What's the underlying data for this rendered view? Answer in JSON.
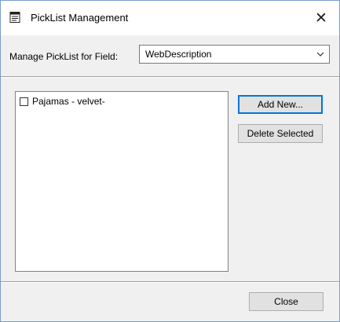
{
  "window": {
    "title": "PickList Management",
    "title_icon": "notepad-icon",
    "close_glyph": "✕"
  },
  "field_selector": {
    "label": "Manage PickList for Field:",
    "selected_value": "WebDescription"
  },
  "picklist": {
    "items": [
      {
        "label": "Pajamas - velvet-",
        "checked": false
      }
    ]
  },
  "buttons": {
    "add_new": "Add New...",
    "delete_selected": "Delete Selected",
    "close": "Close"
  },
  "colors": {
    "accent": "#0078d7",
    "window_border": "#7a9ccc",
    "panel_bg": "#f0f0f0"
  }
}
